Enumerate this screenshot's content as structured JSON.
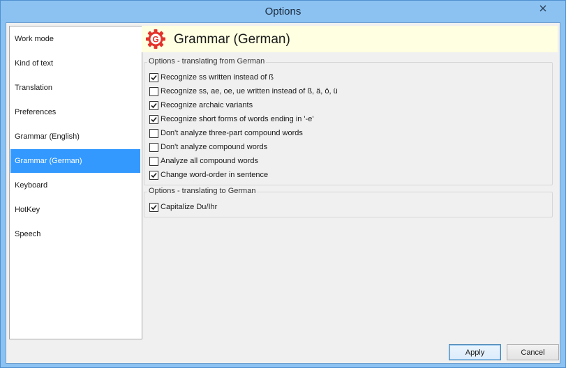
{
  "window": {
    "title": "Options"
  },
  "sidebar": {
    "items": [
      {
        "label": "Work mode",
        "selected": false
      },
      {
        "label": "Kind of text",
        "selected": false
      },
      {
        "label": "Translation",
        "selected": false
      },
      {
        "label": "Preferences",
        "selected": false
      },
      {
        "label": "Grammar (English)",
        "selected": false
      },
      {
        "label": "Grammar (German)",
        "selected": true
      },
      {
        "label": "Keyboard",
        "selected": false
      },
      {
        "label": "HotKey",
        "selected": false
      },
      {
        "label": "Speech",
        "selected": false
      }
    ]
  },
  "header": {
    "title": "Grammar (German)",
    "icon_letter": "G",
    "icon": "gear-g-icon"
  },
  "groups": {
    "from_german": {
      "legend": "Options - translating from German",
      "options": [
        {
          "label": "Recognize ss written instead of ß",
          "checked": true
        },
        {
          "label": "Recognize ss, ae, oe, ue written instead of ß, ä, ö, ü",
          "checked": false
        },
        {
          "label": "Recognize archaic variants",
          "checked": true
        },
        {
          "label": "Recognize short forms of words ending in '-e'",
          "checked": true
        },
        {
          "label": "Don't analyze three-part compound words",
          "checked": false
        },
        {
          "label": "Don't analyze compound words",
          "checked": false
        },
        {
          "label": "Analyze all compound words",
          "checked": false
        },
        {
          "label": "Change word-order in sentence",
          "checked": true
        }
      ]
    },
    "to_german": {
      "legend": "Options - translating to German",
      "options": [
        {
          "label": "Capitalize Du/Ihr",
          "checked": true
        }
      ]
    }
  },
  "buttons": {
    "apply": "Apply",
    "cancel": "Cancel"
  },
  "colors": {
    "selection": "#3399ff",
    "header_bg": "#ffffe1",
    "icon_red": "#e4322b",
    "titlebar": "#8cc2f2"
  }
}
